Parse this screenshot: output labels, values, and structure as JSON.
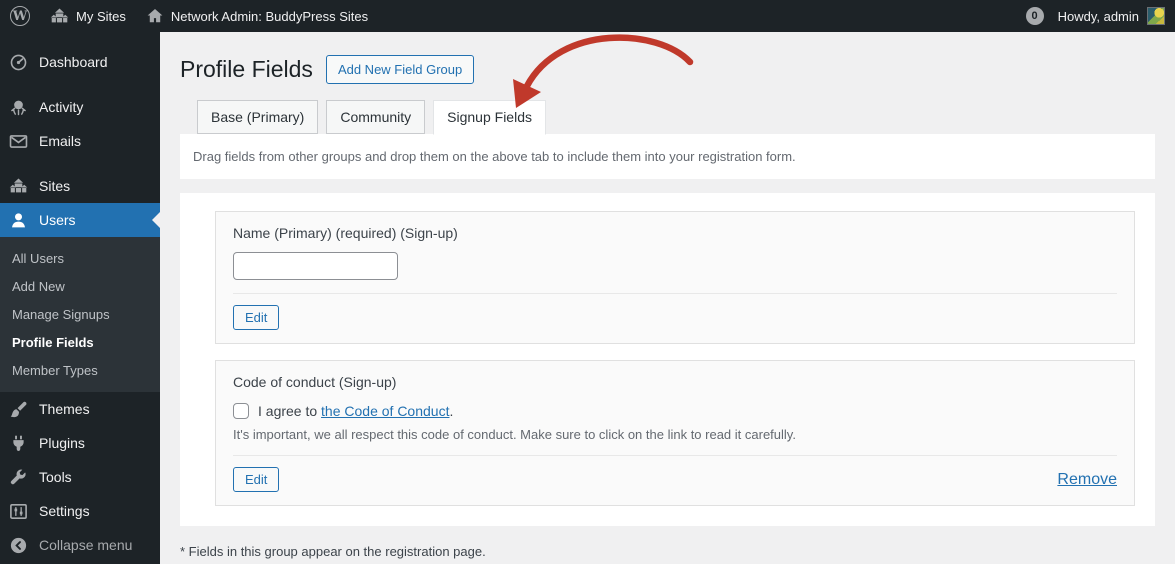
{
  "admin_bar": {
    "my_sites_label": "My Sites",
    "network_label": "Network Admin: BuddyPress Sites",
    "comments_count": "0",
    "howdy_label": "Howdy, admin"
  },
  "sidebar": {
    "dashboard": "Dashboard",
    "activity": "Activity",
    "emails": "Emails",
    "sites": "Sites",
    "users": "Users",
    "users_submenu": [
      {
        "label": "All Users"
      },
      {
        "label": "Add New"
      },
      {
        "label": "Manage Signups"
      },
      {
        "label": "Profile Fields"
      },
      {
        "label": "Member Types"
      }
    ],
    "themes": "Themes",
    "plugins": "Plugins",
    "tools": "Tools",
    "settings": "Settings",
    "collapse": "Collapse menu"
  },
  "page": {
    "title": "Profile Fields",
    "add_new_button": "Add New Field Group",
    "tabs": [
      {
        "label": "Base (Primary)"
      },
      {
        "label": "Community"
      },
      {
        "label": "Signup Fields"
      }
    ],
    "notice": "Drag fields from other groups and drop them on the above tab to include them into your registration form.",
    "cards": [
      {
        "label": "Name (Primary) (required) (Sign-up)",
        "input_value": "",
        "edit_button": "Edit"
      },
      {
        "label": "Code of conduct (Sign-up)",
        "agree_prefix": "I agree to ",
        "agree_link": "the Code of Conduct",
        "agree_suffix": ".",
        "description": "It's important, we all respect this code of conduct. Make sure to click on the link to read it carefully.",
        "edit_button": "Edit",
        "remove_link": "Remove"
      }
    ],
    "footnote": "* Fields in this group appear on the registration page."
  },
  "icons": {
    "wordpress_logo": "W",
    "my_sites": "houses",
    "network_home": "house",
    "comments": "bubble-count",
    "dashboard": "gauge",
    "activity": "buddypress-bug",
    "emails": "envelope",
    "sites": "houses",
    "users": "person",
    "themes": "paintbrush",
    "plugins": "plug",
    "tools": "wrench",
    "settings": "sliders-panel",
    "collapse": "circle-left-arrow",
    "annotation": "red-curved-arrow"
  },
  "colors": {
    "admin_bar_bg": "#1d2327",
    "submenu_bg": "#2c3338",
    "active_blue": "#2271b1",
    "page_bg": "#f0f0f1",
    "link_blue": "#2271b1",
    "arrow_red": "#c0392b"
  }
}
